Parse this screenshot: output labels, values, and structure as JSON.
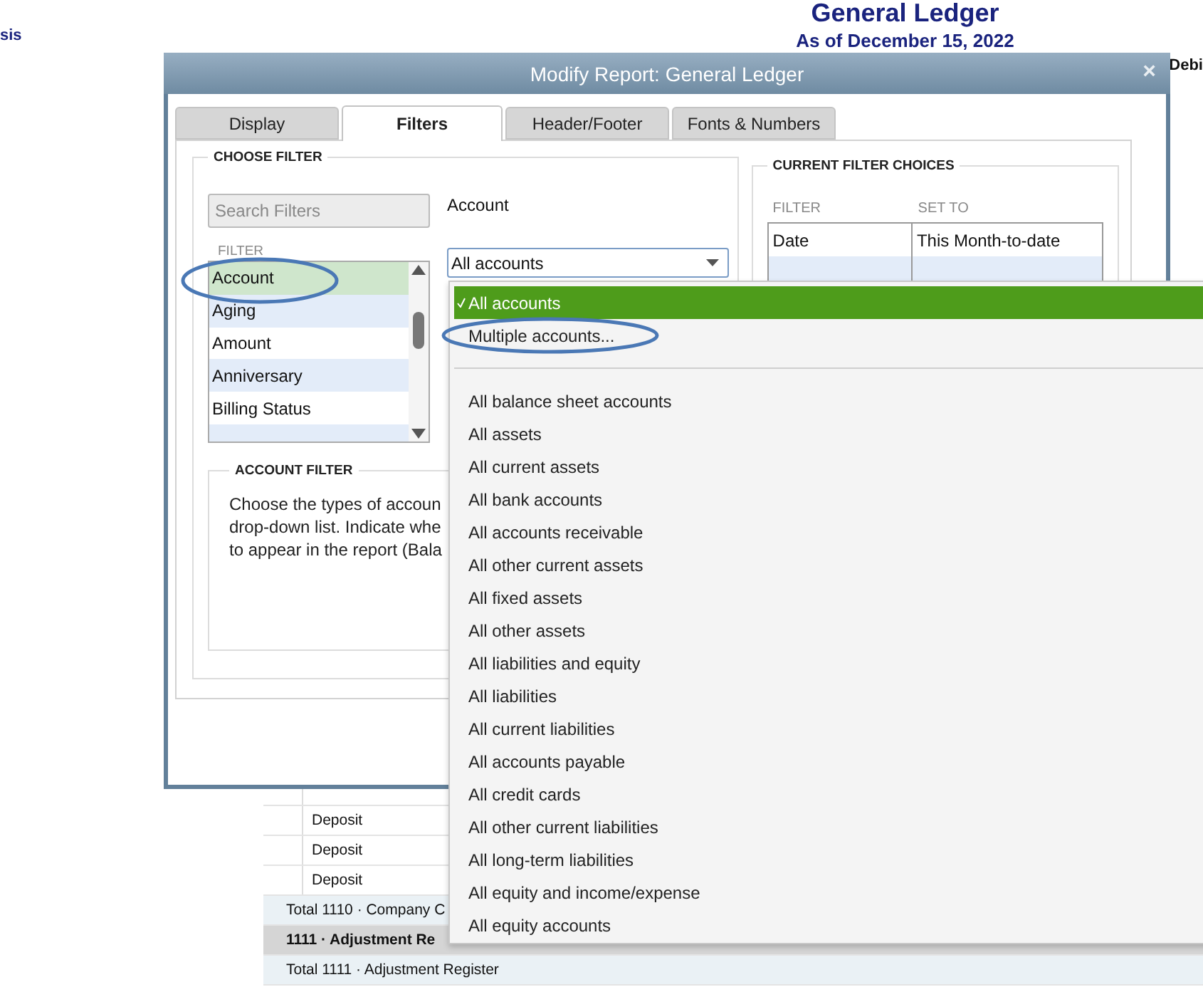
{
  "report": {
    "left_fragment": "sis",
    "title": "General Ledger",
    "subtitle": "As of December 15, 2022",
    "column_fragment": "Debi",
    "rows": [
      {
        "kind": "detail",
        "text": "Deposit"
      },
      {
        "kind": "detail",
        "text": "Deposit"
      },
      {
        "kind": "detail",
        "text": "Deposit"
      },
      {
        "kind": "total",
        "text": "Total 1110 · Company C"
      },
      {
        "kind": "account",
        "text": "1111 · Adjustment Re"
      },
      {
        "kind": "total",
        "text": "Total 1111 · Adjustment Register"
      }
    ]
  },
  "dialog": {
    "title": "Modify Report: General Ledger",
    "close": "×",
    "tabs": [
      {
        "label": "Display",
        "selected": false
      },
      {
        "label": "Filters",
        "selected": true
      },
      {
        "label": "Header/Footer",
        "selected": false
      },
      {
        "label": "Fonts & Numbers",
        "selected": false
      }
    ],
    "choose_filter": {
      "heading": "CHOOSE FILTER",
      "search": {
        "placeholder": "Search Filters"
      },
      "list_heading": "FILTER",
      "items": [
        {
          "label": "Account",
          "selected": true
        },
        {
          "label": "Aging",
          "selected": false
        },
        {
          "label": "Amount",
          "selected": false
        },
        {
          "label": "Anniversary",
          "selected": false
        },
        {
          "label": "Billing Status",
          "selected": false
        }
      ],
      "field_label": "Account",
      "combo_value": "All accounts"
    },
    "account_filter": {
      "heading": "ACCOUNT FILTER",
      "lines": [
        "Choose the types of accoun",
        "drop-down list. Indicate whe",
        "to appear in the report (Bala"
      ]
    },
    "current_filters": {
      "heading": "CURRENT FILTER CHOICES",
      "columns": [
        "FILTER",
        "SET TO"
      ],
      "rows": [
        {
          "filter": "Date",
          "set_to": "This Month-to-date"
        }
      ]
    }
  },
  "dropdown": {
    "items": [
      {
        "kind": "option",
        "label": "All accounts",
        "selected": true
      },
      {
        "kind": "option",
        "label": "Multiple accounts...",
        "selected": false
      },
      {
        "kind": "separator"
      },
      {
        "kind": "option",
        "label": "All balance sheet accounts",
        "selected": false
      },
      {
        "kind": "option",
        "label": "All assets",
        "selected": false
      },
      {
        "kind": "option",
        "label": "All current assets",
        "selected": false
      },
      {
        "kind": "option",
        "label": "All bank accounts",
        "selected": false
      },
      {
        "kind": "option",
        "label": "All accounts receivable",
        "selected": false
      },
      {
        "kind": "option",
        "label": "All other current assets",
        "selected": false
      },
      {
        "kind": "option",
        "label": "All fixed assets",
        "selected": false
      },
      {
        "kind": "option",
        "label": "All other assets",
        "selected": false
      },
      {
        "kind": "option",
        "label": "All liabilities and equity",
        "selected": false
      },
      {
        "kind": "option",
        "label": "All liabilities",
        "selected": false
      },
      {
        "kind": "option",
        "label": "All current liabilities",
        "selected": false
      },
      {
        "kind": "option",
        "label": "All accounts payable",
        "selected": false
      },
      {
        "kind": "option",
        "label": "All credit cards",
        "selected": false
      },
      {
        "kind": "option",
        "label": "All other current liabilities",
        "selected": false
      },
      {
        "kind": "option",
        "label": "All long-term liabilities",
        "selected": false
      },
      {
        "kind": "option",
        "label": "All equity and income/expense",
        "selected": false
      },
      {
        "kind": "option",
        "label": "All equity accounts",
        "selected": false
      }
    ]
  }
}
